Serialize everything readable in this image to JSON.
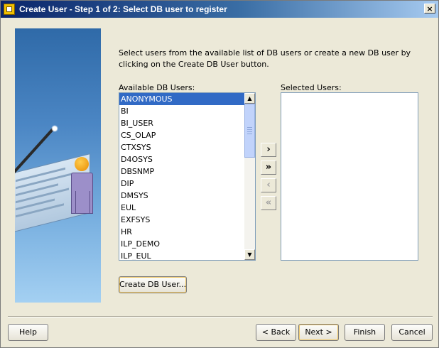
{
  "window": {
    "title": "Create User - Step 1 of 2: Select DB user to register",
    "close_glyph": "×"
  },
  "instructions": "Select users from the available list of DB users or create a new DB user by clicking on the Create DB User button.",
  "available": {
    "label": "Available DB Users:",
    "selected_index": 0,
    "items": [
      "ANONYMOUS",
      "BI",
      "BI_USER",
      "CS_OLAP",
      "CTXSYS",
      "D4OSYS",
      "DBSNMP",
      "DIP",
      "DMSYS",
      "EUL",
      "EXFSYS",
      "HR",
      "ILP_DEMO",
      "ILP_EUL"
    ],
    "scroll_up": "▲",
    "scroll_down": "▼"
  },
  "selected": {
    "label": "Selected Users:",
    "items": []
  },
  "move_buttons": {
    "add": "›",
    "add_all": "»",
    "remove": "‹",
    "remove_all": "«"
  },
  "buttons": {
    "create_db_user": "Create DB User...",
    "help": "Help",
    "back": "< Back",
    "next": "Next >",
    "finish": "Finish",
    "cancel": "Cancel"
  }
}
